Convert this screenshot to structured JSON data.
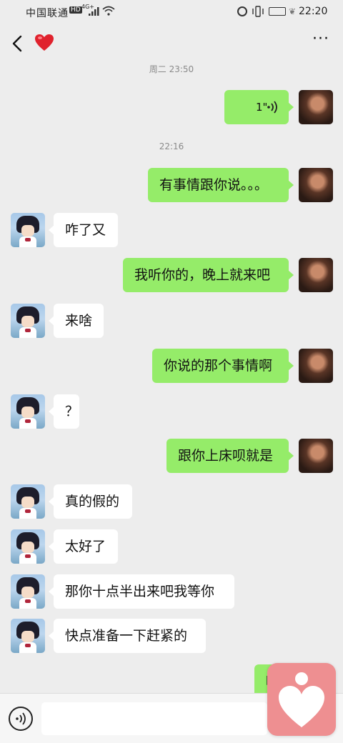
{
  "status_bar": {
    "carrier": "中国联通",
    "hd_badge": "HD",
    "network": "4G+",
    "time": "22:20",
    "icons": [
      "signal-icon",
      "wifi-icon",
      "alarm-icon",
      "vibrate-icon",
      "battery-icon",
      "eco-leaf-icon"
    ]
  },
  "nav": {
    "title_icon": "heart-icon",
    "back_icon": "chevron-left-icon",
    "more_label": "···"
  },
  "timestamps": [
    "周二 23:50",
    "22:16"
  ],
  "messages": [
    {
      "side": "out",
      "type": "voice",
      "duration": "1\""
    },
    {
      "side": "out",
      "text": "有事情跟你说。。。"
    },
    {
      "side": "in",
      "text": "咋了又"
    },
    {
      "side": "out",
      "text": "我听你的，晚上就来吧"
    },
    {
      "side": "in",
      "text": "来啥"
    },
    {
      "side": "out",
      "text": "你说的那个事情啊"
    },
    {
      "side": "in",
      "text": "？"
    },
    {
      "side": "out",
      "text": "跟你上床呗就是"
    },
    {
      "side": "in",
      "text": "真的假的"
    },
    {
      "side": "in",
      "text": "太好了"
    },
    {
      "side": "in",
      "text": "那你十点半出来吧我等你"
    },
    {
      "side": "in",
      "text": "快点准备一下赶紧的"
    },
    {
      "side": "out",
      "text": "嗯"
    }
  ],
  "input": {
    "placeholder": "",
    "voice_toggle_icon": "voice-input-icon"
  },
  "floating_app": {
    "icon": "heart-person-icon"
  },
  "colors": {
    "background": "#ededed",
    "out_bubble": "#95ec69",
    "in_bubble": "#ffffff",
    "float_app": "#ee8f91"
  }
}
